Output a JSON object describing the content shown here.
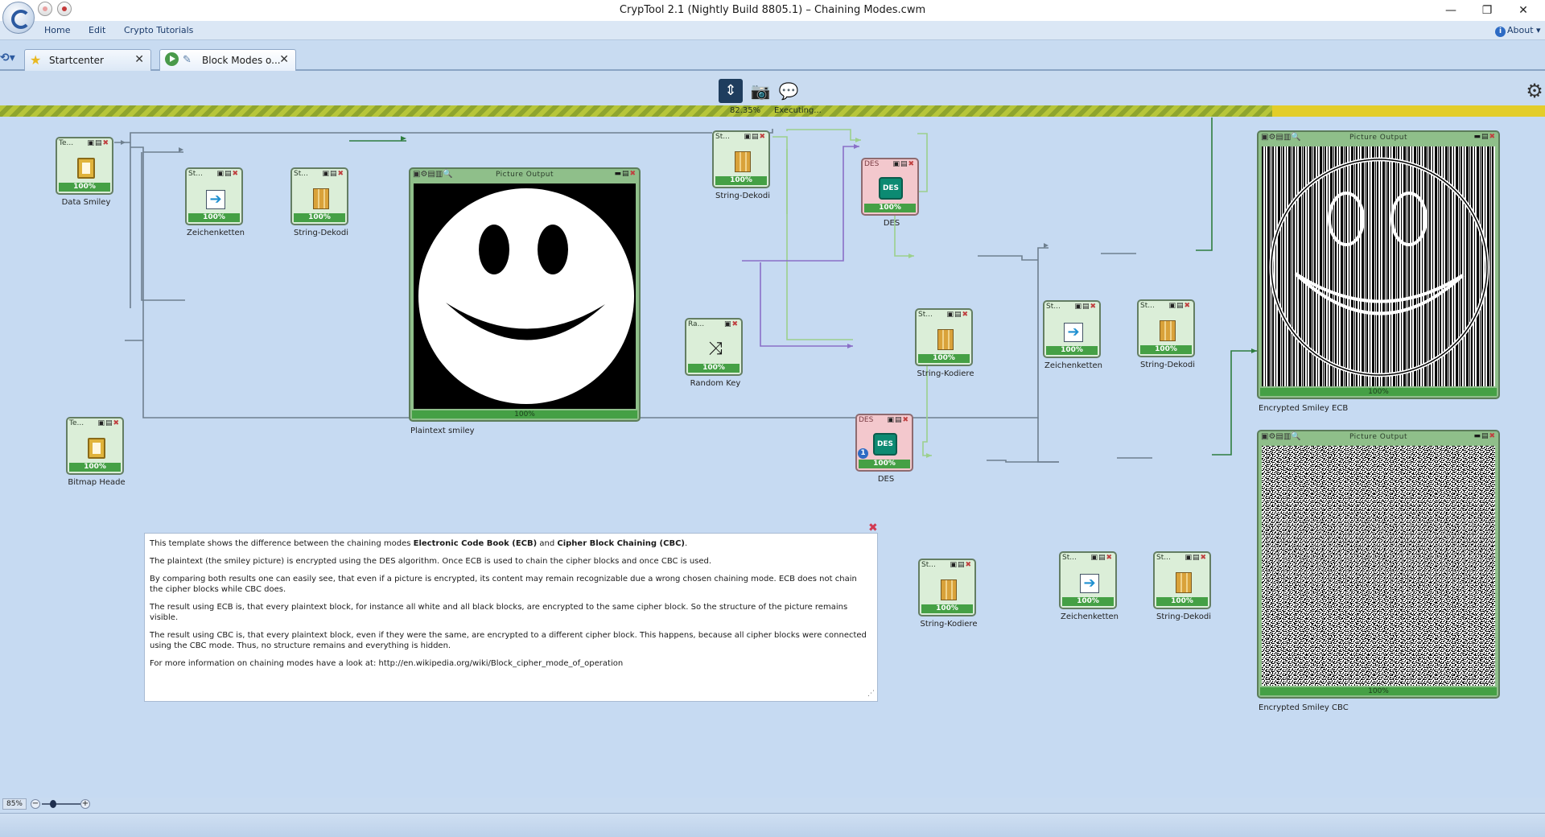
{
  "window": {
    "title": "CrypTool 2.1 (Nightly Build 8805.1) – Chaining Modes.cwm",
    "minimize": "—",
    "restore": "❐",
    "close": "✕"
  },
  "ribbon": {
    "tabs": [
      "Home",
      "Edit",
      "Crypto Tutorials"
    ],
    "about": "About"
  },
  "doc_tabs": {
    "start": "Startcenter",
    "block": "Block Modes o...",
    "close_glyph": "✕"
  },
  "progress": {
    "percent_text": "82.35%",
    "fraction": 0.8235,
    "status": "Executing..."
  },
  "pct": "100%",
  "components": {
    "data_smiley": {
      "head": "Te...",
      "label": "Data Smiley"
    },
    "bitmap_header": {
      "head": "Te...",
      "label": "Bitmap Heade"
    },
    "zeichenketten_1": {
      "head": "St...",
      "label": "Zeichenketten"
    },
    "string_dekodi_1": {
      "head": "St...",
      "label": "String-Dekodi"
    },
    "string_dekodi_top": {
      "head": "St...",
      "label": "String-Dekodi"
    },
    "random_key": {
      "head": "Ra...",
      "label": "Random Key"
    },
    "des_ecb": {
      "head": "DES",
      "icon_text": "DES",
      "label": "DES"
    },
    "des_cbc": {
      "head": "DES",
      "icon_text": "DES",
      "label": "DES",
      "badge": "1"
    },
    "string_kodiere_ecb": {
      "head": "St...",
      "label": "String-Kodiere"
    },
    "zeichenketten_ecb": {
      "head": "St...",
      "label": "Zeichenketten"
    },
    "string_dekodi_ecb": {
      "head": "St...",
      "label": "String-Dekodi"
    },
    "string_kodiere_cbc": {
      "head": "St...",
      "label": "String-Kodiere"
    },
    "zeichenketten_cbc": {
      "head": "St...",
      "label": "Zeichenketten"
    },
    "string_dekodi_cbc": {
      "head": "St...",
      "label": "String-Dekodi"
    }
  },
  "picture_outputs": {
    "plain": {
      "title": "Picture Output",
      "label": "Plaintext smiley"
    },
    "ecb": {
      "title": "Picture Output",
      "label": "Encrypted Smiley ECB"
    },
    "cbc": {
      "title": "Picture Output",
      "label": "Encrypted Smiley CBC"
    }
  },
  "note": {
    "p1_a": "This template shows the difference between the chaining modes ",
    "p1_b": "Electronic Code Book (ECB)",
    "p1_c": " and ",
    "p1_d": "Cipher Block Chaining (CBC)",
    "p1_e": ".",
    "p2": "The plaintext (the smiley picture) is encrypted using the DES algorithm. Once ECB is used to chain the cipher blocks and once CBC is used.",
    "p3": "By comparing both results one can easily see, that even if a picture is encrypted, its content may remain recognizable due a wrong chosen chaining mode. ECB does not chain the cipher blocks while CBC does.",
    "p4": "The result using ECB is, that every plaintext block, for instance all white and all black blocks, are encrypted to the same cipher block. So the structure of the picture remains visible.",
    "p5": "The result using CBC is, that every plaintext block, even if they were the same, are encrypted to a different cipher block. This happens, because all cipher blocks were connected using the CBC mode. Thus, no structure remains and everything is hidden.",
    "p6": "For more information on chaining modes have a look at: http://en.wikipedia.org/wiki/Block_cipher_mode_of_operation"
  },
  "zoom": {
    "label": "85%",
    "value_percent": 85
  },
  "colors": {
    "wire_gray": "#6e7f8f",
    "wire_green": "#2f7d3f",
    "wire_lightgreen": "#9cd08c",
    "wire_purple": "#8a6fc7",
    "progress_yellow": "#e3cd2a",
    "component_green": "#dbeed8",
    "component_red": "#f3c8cd"
  }
}
